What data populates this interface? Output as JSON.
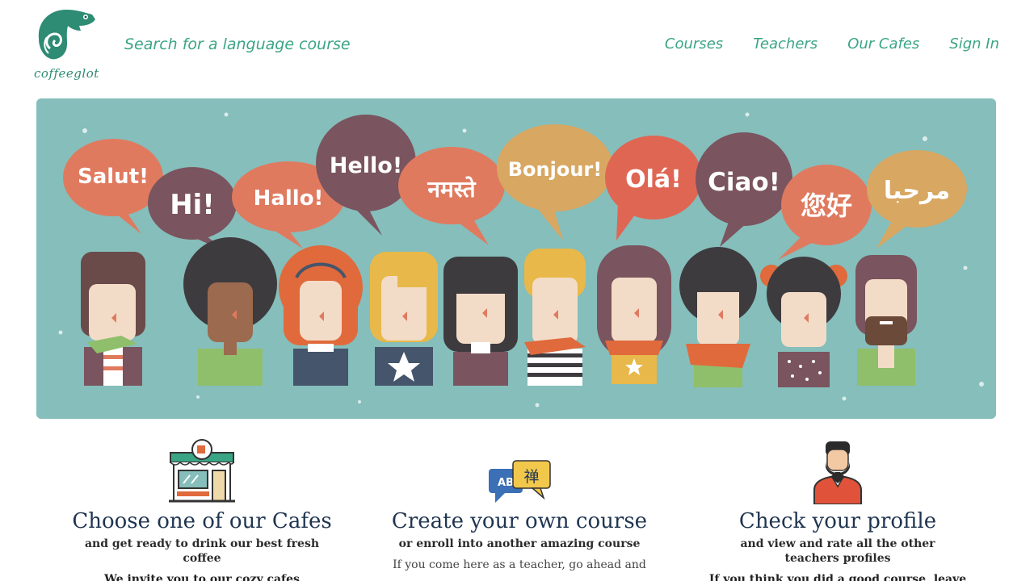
{
  "brand": {
    "name": "coffeeglot"
  },
  "header": {
    "search_link": "Search for a language course",
    "nav": [
      "Courses",
      "Teachers",
      "Our Cafes",
      "Sign In"
    ]
  },
  "hero": {
    "greetings": [
      "Salut!",
      "Hi!",
      "Hallo!",
      "Hello!",
      "नमस्ते",
      "Bonjour!",
      "Olá!",
      "Ciao!",
      "您好",
      "مرحبا"
    ]
  },
  "features": [
    {
      "icon": "cafe-storefront-icon",
      "title": "Choose one of our Cafes",
      "subtitle": "and get ready to drink our best fresh coffee",
      "body": "We invite you to our cozy cafes"
    },
    {
      "icon": "translation-bubbles-icon",
      "title": "Create your own course",
      "subtitle": "or enroll into another amazing course",
      "body": "If you come here as a teacher, go ahead and"
    },
    {
      "icon": "bearded-teacher-icon",
      "title": "Check your profile",
      "subtitle": "and view and rate all the other teachers profiles",
      "body": "If you think you did a good course, leave"
    }
  ],
  "colors": {
    "accent": "#3aa584",
    "hero_bg": "#85bebb",
    "title": "#1f3550"
  }
}
